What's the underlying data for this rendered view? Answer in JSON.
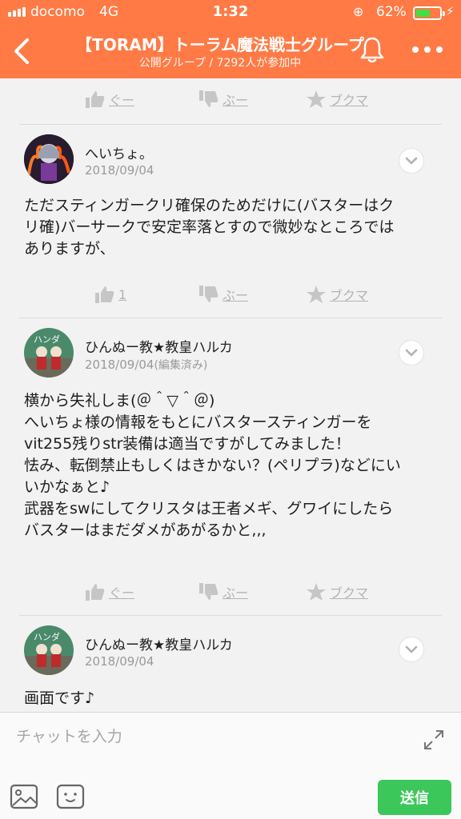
{
  "status": {
    "carrier": "docomo",
    "network": "4G",
    "time": "1:32",
    "battery": "62%",
    "battery_level": 0.62
  },
  "header": {
    "title": "【TORAM】トーラム魔法戦士グループ",
    "subtitle": "公開グループ / 7292人が参加中"
  },
  "posts": [
    {
      "actions": {
        "like": "ぐー",
        "dislike": "ぶー",
        "bookmark": "ブクマ"
      }
    },
    {
      "author": "へいちょ。",
      "date": "2018/09/04",
      "body": [
        "ただスティンガークリ確保のためだけに(バスターはク",
        "リ確)バーサークで安定率落とすので微妙なところでは",
        "ありますが、"
      ],
      "actions": {
        "like": "1",
        "dislike": "ぶー",
        "bookmark": "ブクマ"
      }
    },
    {
      "author": "ひんぬー教★教皇ハルカ",
      "date": "2018/09/04",
      "edited": "(編集済み)",
      "avatar_text": "ハンダ",
      "body": [
        "横から失礼しま(＠＾▽＾＠)",
        "へいちょ様の情報をもとにバスタースティンガーを",
        "vit255残りstr装備は適当ですがしてみました！",
        "怯み、転倒禁止もしくはきかない？(ペリプラ)などにい",
        "いかなぁと♪",
        "武器をswにしてクリスタは王者メギ、グワイにしたら",
        "バスターはまだダメがあがるかと,,,"
      ],
      "actions": {
        "like": "ぐー",
        "dislike": "ぶー",
        "bookmark": "ブクマ"
      }
    },
    {
      "author": "ひんぬー教★教皇ハルカ",
      "date": "2018/09/04",
      "avatar_text": "ハンダ",
      "body": [
        "画面です♪"
      ]
    }
  ],
  "composer": {
    "placeholder": "チャットを入力",
    "send_label": "送信"
  },
  "colors": {
    "header": "#ff7a45",
    "send": "#3bc75a"
  }
}
